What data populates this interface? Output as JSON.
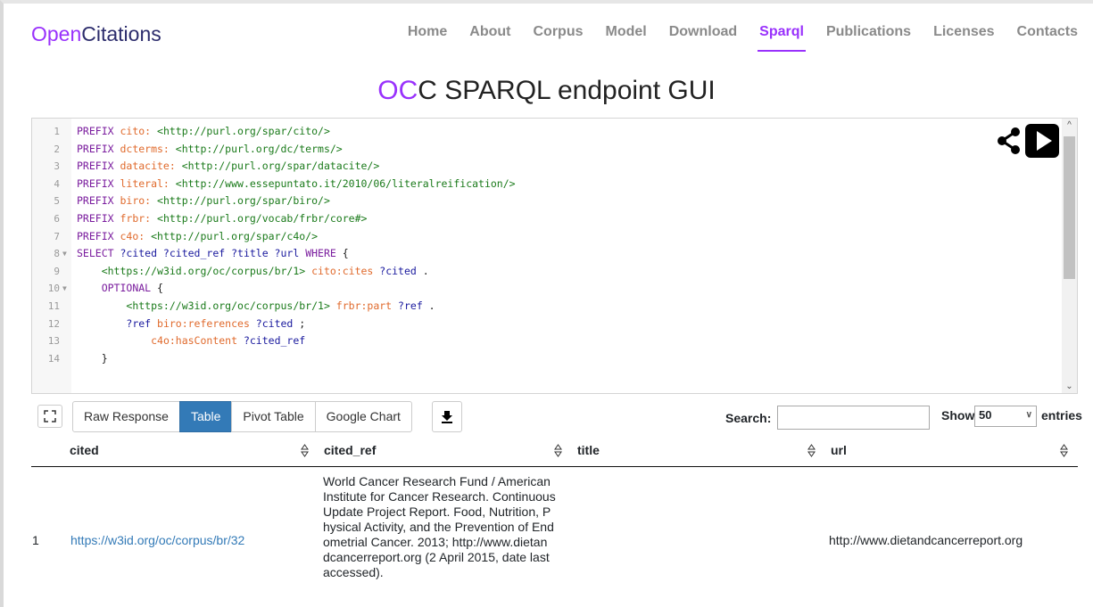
{
  "nav": {
    "brand_part1": "Open",
    "brand_part2": "Citations",
    "links": [
      "Home",
      "About",
      "Corpus",
      "Model",
      "Download",
      "Sparql",
      "Publications",
      "Licenses",
      "Contacts"
    ],
    "active": "Sparql",
    "accent": "#9931fc"
  },
  "title": {
    "highlight": "OC",
    "rest": "C SPARQL endpoint GUI"
  },
  "editor": {
    "lines": [
      {
        "n": "1",
        "fold": "",
        "parts": [
          [
            "kw",
            "PREFIX "
          ],
          [
            "pf",
            "cito: "
          ],
          [
            "ur",
            "<http://purl.org/spar/cito/>"
          ]
        ]
      },
      {
        "n": "2",
        "fold": "",
        "parts": [
          [
            "kw",
            "PREFIX "
          ],
          [
            "pf",
            "dcterms: "
          ],
          [
            "ur",
            "<http://purl.org/dc/terms/>"
          ]
        ]
      },
      {
        "n": "3",
        "fold": "",
        "parts": [
          [
            "kw",
            "PREFIX "
          ],
          [
            "pf",
            "datacite: "
          ],
          [
            "ur",
            "<http://purl.org/spar/datacite/>"
          ]
        ]
      },
      {
        "n": "4",
        "fold": "",
        "parts": [
          [
            "kw",
            "PREFIX "
          ],
          [
            "pf",
            "literal: "
          ],
          [
            "ur",
            "<http://www.essepuntato.it/2010/06/literalreification/>"
          ]
        ]
      },
      {
        "n": "5",
        "fold": "",
        "parts": [
          [
            "kw",
            "PREFIX "
          ],
          [
            "pf",
            "biro: "
          ],
          [
            "ur",
            "<http://purl.org/spar/biro/>"
          ]
        ]
      },
      {
        "n": "6",
        "fold": "",
        "parts": [
          [
            "kw",
            "PREFIX "
          ],
          [
            "pf",
            "frbr: "
          ],
          [
            "ur",
            "<http://purl.org/vocab/frbr/core#>"
          ]
        ]
      },
      {
        "n": "7",
        "fold": "",
        "parts": [
          [
            "kw",
            "PREFIX "
          ],
          [
            "pf",
            "c4o: "
          ],
          [
            "ur",
            "<http://purl.org/spar/c4o/>"
          ]
        ]
      },
      {
        "n": "8",
        "fold": "▼",
        "parts": [
          [
            "kw",
            "SELECT "
          ],
          [
            "vr",
            "?cited ?cited_ref ?title ?url "
          ],
          [
            "kw",
            "WHERE "
          ],
          [
            "tx",
            "{"
          ]
        ]
      },
      {
        "n": "9",
        "fold": "",
        "parts": [
          [
            "tx",
            "    "
          ],
          [
            "ur",
            "<https://w3id.org/oc/corpus/br/1> "
          ],
          [
            "pf",
            "cito:cites "
          ],
          [
            "vr",
            "?cited "
          ],
          [
            "tx",
            "."
          ]
        ]
      },
      {
        "n": "10",
        "fold": "▼",
        "parts": [
          [
            "tx",
            "    "
          ],
          [
            "kw",
            "OPTIONAL "
          ],
          [
            "tx",
            "{"
          ]
        ]
      },
      {
        "n": "11",
        "fold": "",
        "parts": [
          [
            "tx",
            "        "
          ],
          [
            "ur",
            "<https://w3id.org/oc/corpus/br/1> "
          ],
          [
            "pf",
            "frbr:part "
          ],
          [
            "vr",
            "?ref "
          ],
          [
            "tx",
            "."
          ]
        ]
      },
      {
        "n": "12",
        "fold": "",
        "parts": [
          [
            "tx",
            "        "
          ],
          [
            "vr",
            "?ref "
          ],
          [
            "pf",
            "biro:references "
          ],
          [
            "vr",
            "?cited "
          ],
          [
            "tx",
            ";"
          ]
        ]
      },
      {
        "n": "13",
        "fold": "",
        "parts": [
          [
            "tx",
            "            "
          ],
          [
            "pf",
            "c4o:hasContent "
          ],
          [
            "vr",
            "?cited_ref"
          ]
        ]
      },
      {
        "n": "14",
        "fold": "",
        "parts": [
          [
            "tx",
            "    }"
          ]
        ]
      }
    ]
  },
  "toolbar": {
    "tabs": [
      "Raw Response",
      "Table",
      "Pivot Table",
      "Google Chart"
    ],
    "active_tab": "Table",
    "search_label": "Search:",
    "search_value": "",
    "show_label": "Show",
    "show_value": "50",
    "entries_label": "entries"
  },
  "table": {
    "columns": [
      "cited",
      "cited_ref",
      "title",
      "url"
    ],
    "rows": [
      {
        "num": "1",
        "cited": "https://w3id.org/oc/corpus/br/32",
        "cited_ref": "World Cancer Research Fund / American Institute for Cancer Research. Continuous Update Project Report. Food, Nutrition, P hysical Activity, and the Prevention of End ometrial Cancer. 2013; http://www.dietan dcancerreport.org (2 April 2015, date last accessed).",
        "cited_ref_lines": [
          "World Cancer Research Fund / American",
          "Institute for Cancer Research. Continuous",
          "Update Project Report. Food, Nutrition, P",
          "hysical Activity, and the Prevention of End",
          "ometrial Cancer. 2013; http://www.dietan",
          "dcancerreport.org (2 April 2015, date last",
          "accessed)."
        ],
        "title": "",
        "url": "http://www.dietandcancerreport.org"
      }
    ]
  },
  "colors": {
    "active_tab_bg": "#337ab7",
    "link": "#337ab7"
  }
}
